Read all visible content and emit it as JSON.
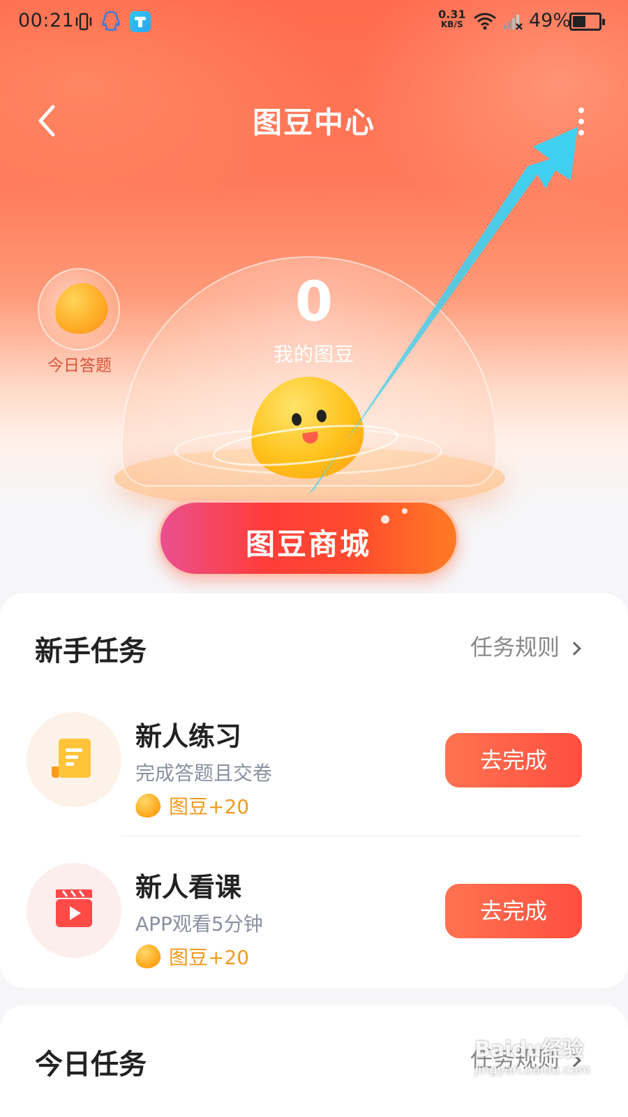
{
  "status_bar": {
    "time": "00:21",
    "speed_value": "0.31",
    "speed_unit": "KB/S",
    "battery_percent": "49%",
    "battery_level": 0.49
  },
  "header": {
    "title": "图豆中心"
  },
  "hero": {
    "bean_count": "0",
    "bean_count_label": "我的图豆",
    "daily_quiz_label": "今日答题",
    "mall_button_label": "图豆商城"
  },
  "newbie_section": {
    "title": "新手任务",
    "rules_link": "任务规则",
    "tasks": [
      {
        "name": "新人练习",
        "description": "完成答题且交卷",
        "reward": "图豆+20",
        "button": "去完成",
        "icon": "scroll-document-icon"
      },
      {
        "name": "新人看课",
        "description": "APP观看5分钟",
        "reward": "图豆+20",
        "button": "去完成",
        "icon": "video-clapper-icon"
      }
    ]
  },
  "daily_section": {
    "title": "今日任务",
    "rules_link": "任务规则"
  },
  "colors": {
    "hero_top": "#ff6a4d",
    "accent_button": "#ff5a44",
    "reward_text": "#f29a20",
    "annotation_arrow": "#3fd0f0"
  },
  "watermark": {
    "brand": "Baidu经验",
    "url": "jingyan.baidu.com"
  }
}
